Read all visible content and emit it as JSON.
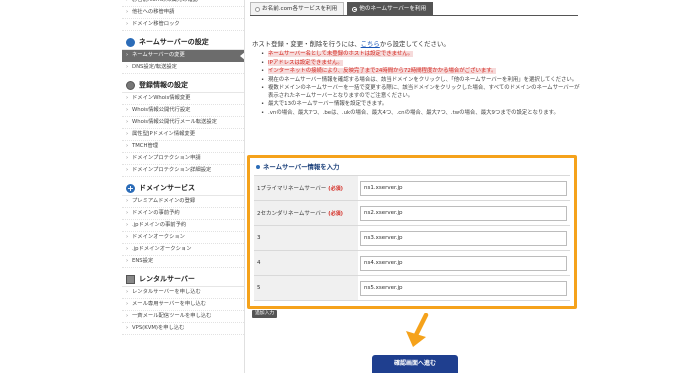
{
  "sidebar": {
    "top_items": [
      "お名前.comの帰属先の確認",
      "他社への移管申請",
      "ドメイン移管ロック"
    ],
    "sections": [
      {
        "title": "ネームサーバーの設定",
        "icon": "globe-icon",
        "items": [
          {
            "label": "ネームサーバーの変更",
            "active": true
          },
          {
            "label": "DNS設定/転送設定",
            "active": false
          }
        ]
      },
      {
        "title": "登録情報の設定",
        "icon": "disk-icon",
        "items": [
          {
            "label": "ドメインWhois情報変更",
            "active": false
          },
          {
            "label": "Whois情報公開代行設定",
            "active": false
          },
          {
            "label": "Whois情報公開代行メール転送設定",
            "active": false
          },
          {
            "label": "属性型JPドメイン情報変更",
            "active": false
          },
          {
            "label": "TMCH管理",
            "active": false
          },
          {
            "label": "ドメインプロテクション申請",
            "active": false
          },
          {
            "label": "ドメインプロテクション詳細設定",
            "active": false
          }
        ]
      },
      {
        "title": "ドメインサービス",
        "icon": "plus-icon",
        "items": [
          {
            "label": "プレミアムドメインの登録",
            "active": false
          },
          {
            "label": "ドメインの事前予約",
            "active": false
          },
          {
            "label": ".jpドメインの事前予約",
            "active": false
          },
          {
            "label": "ドメインオークション",
            "active": false
          },
          {
            "label": ".jpドメインオークション",
            "active": false
          },
          {
            "label": "ENS設定",
            "active": false
          }
        ]
      },
      {
        "title": "レンタルサーバー",
        "icon": "server-icon",
        "items": [
          {
            "label": "レンタルサーバーを申し込む",
            "active": false
          },
          {
            "label": "メール専用サーバーを申し込む",
            "active": false
          },
          {
            "label": "一斉メール配信ツールを申し込む",
            "active": false
          },
          {
            "label": "VPS(KVM)を申し込む",
            "active": false
          }
        ]
      }
    ]
  },
  "tabs": [
    {
      "label": "お名前.com各サービスを利用",
      "active": false
    },
    {
      "label": "他のネームサーバーを利用",
      "active": true
    }
  ],
  "intro": {
    "before": "ホスト登録・変更・削除を行うには、",
    "link": "こちら",
    "after": "から設定してください。"
  },
  "notes": [
    {
      "text": "ネームサーバー名として未登録のホストは設定できません。",
      "red": true
    },
    {
      "text": "IPアドレスは設定できません。",
      "red": true
    },
    {
      "text": "インターネットの接続により、反映完了まで24時間から72時間程度かかる場合がございます。",
      "red": true
    },
    {
      "text": "現在のネームサーバー情報を確認する場合は、該当ドメインをクリックし、「他のネームサーバーを利用」を選択してください。",
      "red": false
    },
    {
      "text": "複数ドメインのネームサーバーを一括で変更する際に、該当ドメインをクリックした場合、すべてのドメインのネームサーバーが表示されたネームサーバーとなりますのでご注意ください。",
      "red": false
    },
    {
      "text": "最大で13のネームサーバー情報を設定できます。",
      "red": false
    },
    {
      "text": ".vnの場合、最大7つ、.beは、.ukの場合、最大4つ、.cnの場合、最大7つ、.twの場合、最大9つまでの設定となります。",
      "red": false
    }
  ],
  "form": {
    "title": "ネームサーバー情報を入力",
    "required_label": "(必須)",
    "rows": [
      {
        "label": "1プライマリネームサーバー",
        "required": true,
        "value": "ns1.xserver.jp"
      },
      {
        "label": "2セカンダリネームサーバー",
        "required": true,
        "value": "ns2.xserver.jp"
      },
      {
        "label": "3",
        "required": false,
        "value": "ns3.xserver.jp"
      },
      {
        "label": "4",
        "required": false,
        "value": "ns4.xserver.jp"
      },
      {
        "label": "5",
        "required": false,
        "value": "ns5.xserver.jp"
      }
    ],
    "add_button": "追加入力"
  },
  "confirm_button": "確認画面へ進む",
  "colors": {
    "highlight": "#f5a21b",
    "confirm": "#1f3f8f",
    "active_nav": "#6c6c6c",
    "warning": "#d3261e"
  }
}
